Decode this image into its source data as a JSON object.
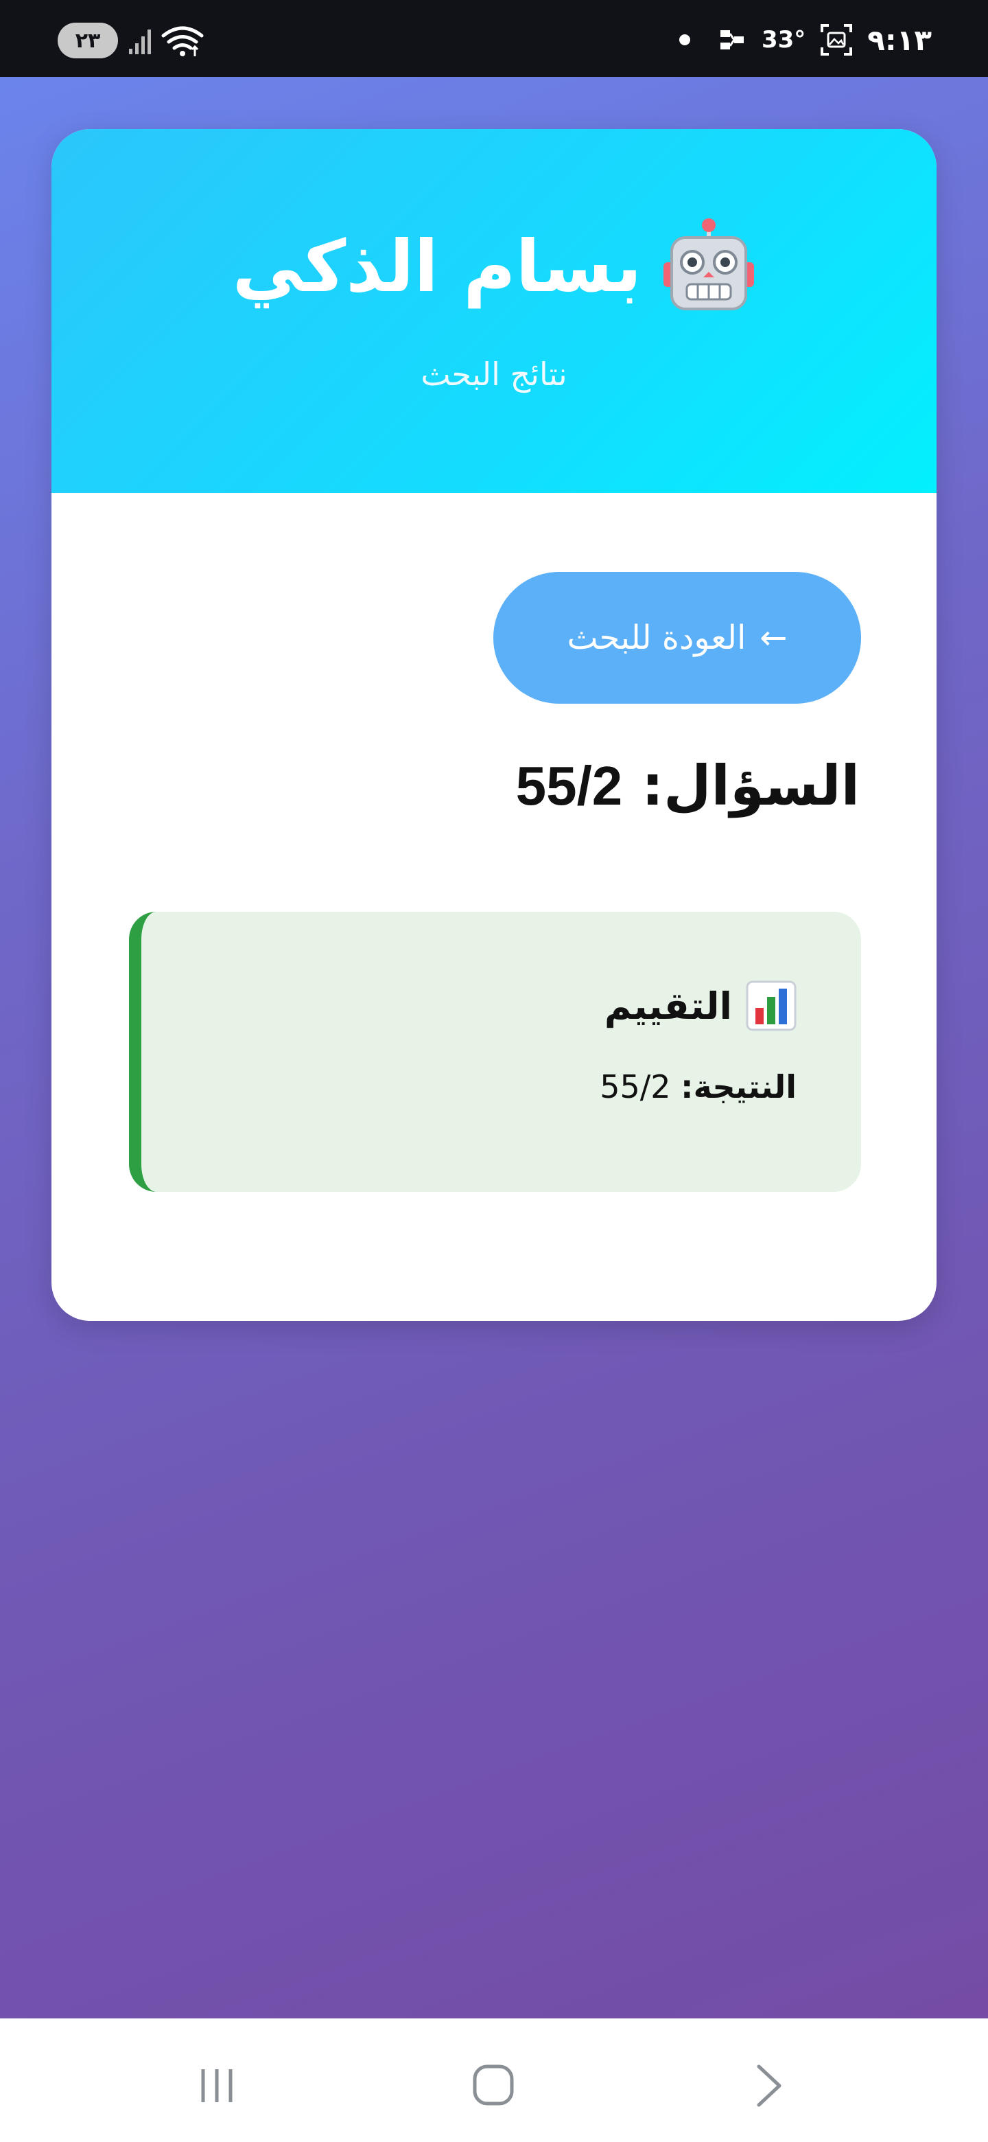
{
  "status_bar": {
    "battery": "٢٣",
    "temperature": "33°",
    "time": "٩:١٣",
    "icons": [
      "signal-icon",
      "wifi-icon",
      "notification-dot-icon",
      "network-icon",
      "screenshot-icon"
    ]
  },
  "header": {
    "title": "بسام الذكي",
    "title_icon": "robot-icon",
    "subtitle": "نتائج البحث"
  },
  "main": {
    "back_button_label": "العودة للبحث",
    "back_button_arrow": "←",
    "question_label": "السؤال:",
    "question_value": "55/2"
  },
  "result": {
    "heading": "التقييم",
    "heading_icon": "bar-chart-icon",
    "result_label": "النتيجة:",
    "result_value": "55/2"
  },
  "nav_bar": {
    "icons": [
      "recent-apps-icon",
      "home-icon",
      "back-icon"
    ]
  },
  "colors": {
    "header_gradient_start": "#2bc6fb",
    "header_gradient_end": "#03f0fe",
    "back_button": "#5cb0f8",
    "result_background": "#e8f3e8",
    "result_accent": "#2ea043",
    "page_gradient_start": "#6b84ec",
    "page_gradient_end": "#744ca6"
  }
}
